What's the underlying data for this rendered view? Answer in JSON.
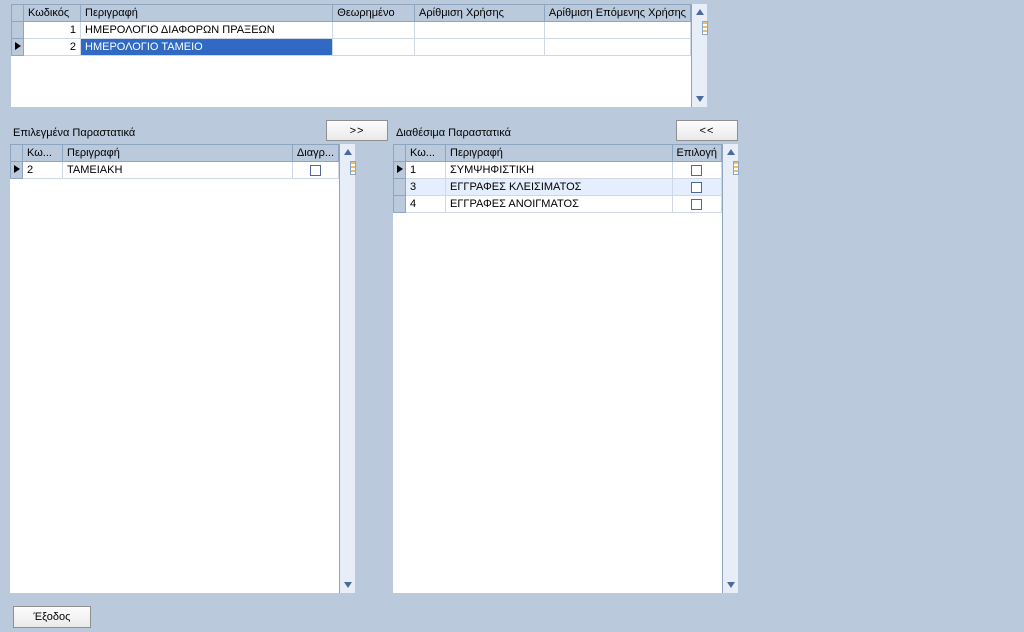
{
  "top_grid": {
    "headers": {
      "code": "Κωδικός",
      "desc": "Περιγραφή",
      "theor": "Θεωρημένο",
      "num_use": "Αρίθμιση Χρήσης",
      "num_next": "Αρίθμιση Επόμενης Χρήσης"
    },
    "rows": [
      {
        "code": "1",
        "desc": "ΗΜΕΡΟΛΟΓΙΟ ΔΙΑΦΟΡΩΝ ΠΡΑΞΕΩΝ",
        "selected": false,
        "current": false
      },
      {
        "code": "2",
        "desc": "ΗΜΕΡΟΛΟΓΙΟ ΤΑΜΕΙΟ",
        "selected": true,
        "current": true
      }
    ]
  },
  "selected_section": {
    "label": "Επιλεγμένα Παραστατικά",
    "btn": ">>",
    "headers": {
      "code": "Κω...",
      "desc": "Περιγραφή",
      "del": "Διαγρ..."
    },
    "rows": [
      {
        "code": "2",
        "desc": "ΤΑΜΕΙΑΚΗ",
        "current": true
      }
    ]
  },
  "available_section": {
    "label": "Διαθέσιμα Παραστατικά",
    "btn": "<<",
    "headers": {
      "code": "Κω...",
      "desc": "Περιγραφή",
      "sel": "Επιλογή"
    },
    "rows": [
      {
        "code": "1",
        "desc": "ΣΥΜΨΗΦΙΣΤΙΚΗ",
        "current": true
      },
      {
        "code": "3",
        "desc": "ΕΓΓΡΑΦΕΣ ΚΛΕΙΣΙΜΑΤΟΣ",
        "highlight": true
      },
      {
        "code": "4",
        "desc": "ΕΓΓΡΑΦΕΣ ΑΝΟΙΓΜΑΤΟΣ"
      }
    ]
  },
  "exit_btn": "Έξοδος"
}
